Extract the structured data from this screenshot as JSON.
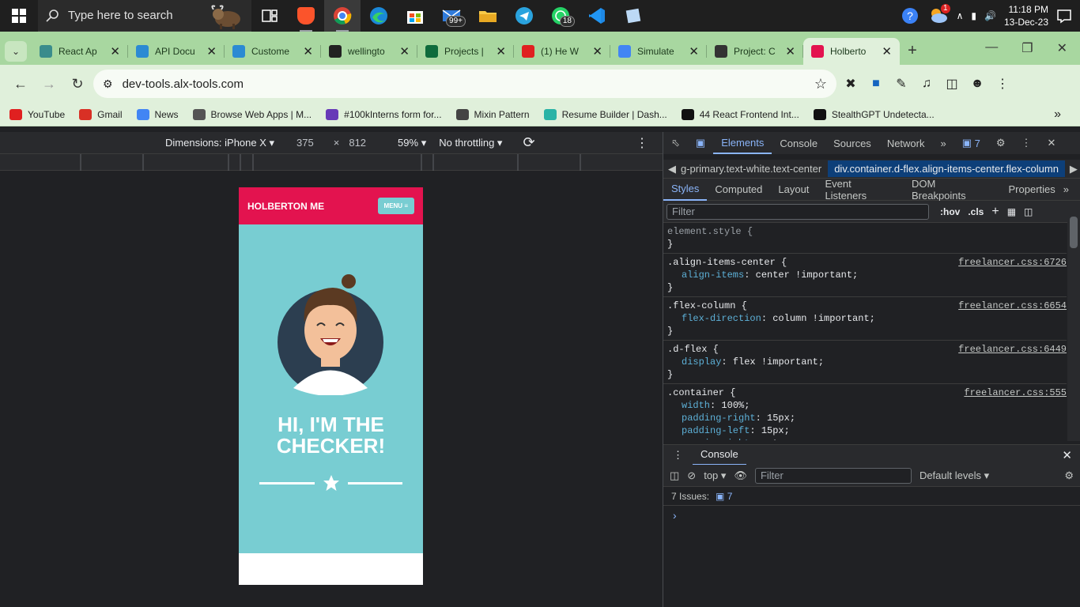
{
  "taskbar": {
    "search_placeholder": "Type here to search",
    "mail_badge": "99+",
    "whatsapp_badge": "18",
    "weather_badge": "1",
    "time": "11:18 PM",
    "date": "13-Dec-23"
  },
  "tabs": [
    {
      "title": "React Ap",
      "fav": "#3a8c8c"
    },
    {
      "title": "API Docu",
      "fav": "#2b8ad3"
    },
    {
      "title": "Custome",
      "fav": "#2b8ad3"
    },
    {
      "title": "wellingto",
      "fav": "#222222"
    },
    {
      "title": "Projects |",
      "fav": "#0e6b3c"
    },
    {
      "title": "(1) He W",
      "fav": "#e02020"
    },
    {
      "title": "Simulate",
      "fav": "#4285f4"
    },
    {
      "title": "Project: C",
      "fav": "#333333"
    },
    {
      "title": "Holberto",
      "fav": "#e3134f"
    }
  ],
  "address": {
    "url": "dev-tools.alx-tools.com"
  },
  "bookmarks": [
    {
      "label": "YouTube",
      "fav": "#e02020"
    },
    {
      "label": "Gmail",
      "fav": "#d93025"
    },
    {
      "label": "News",
      "fav": "#4285f4"
    },
    {
      "label": "Browse Web Apps | M...",
      "fav": "#555555"
    },
    {
      "label": "#100kInterns form for...",
      "fav": "#673ab7"
    },
    {
      "label": "Mixin Pattern",
      "fav": "#444444"
    },
    {
      "label": "Resume Builder | Dash...",
      "fav": "#2ab3a6"
    },
    {
      "label": "44 React Frontend Int...",
      "fav": "#111111"
    },
    {
      "label": "StealthGPT Undetecta...",
      "fav": "#111111"
    }
  ],
  "device_toolbar": {
    "dimensions": "Dimensions: iPhone X",
    "width": "375",
    "times": "×",
    "height": "812",
    "zoom": "59%",
    "throttling": "No throttling"
  },
  "page": {
    "brand": "HOLBERTON ME",
    "menu": "MENU",
    "hero_line1": "HI, I'M THE",
    "hero_line2": "CHECKER!"
  },
  "devtools": {
    "tabs": [
      "Elements",
      "Console",
      "Sources",
      "Network"
    ],
    "issues_count": "7",
    "crumb_left": "g-primary.text-white.text-center",
    "crumb_right": "div.container.d-flex.align-items-center.flex-column",
    "subtabs": [
      "Styles",
      "Computed",
      "Layout",
      "Event Listeners",
      "DOM Breakpoints",
      "Properties"
    ],
    "filter_placeholder": "Filter",
    "hov": ":hov",
    "cls": ".cls",
    "rules": [
      {
        "selector": "element.style {",
        "source": "",
        "props": []
      },
      {
        "selector": ".align-items-center {",
        "source": "freelancer.css:6726",
        "props": [
          {
            "n": "align-items",
            "v": "center !important;"
          }
        ]
      },
      {
        "selector": ".flex-column {",
        "source": "freelancer.css:6654",
        "props": [
          {
            "n": "flex-direction",
            "v": "column !important;"
          }
        ]
      },
      {
        "selector": ".d-flex {",
        "source": "freelancer.css:6449",
        "props": [
          {
            "n": "display",
            "v": "flex !important;"
          }
        ]
      },
      {
        "selector": ".container {",
        "source": "freelancer.css:555",
        "props": [
          {
            "n": "width",
            "v": "100%;"
          },
          {
            "n": "padding-right",
            "v": "15px;"
          },
          {
            "n": "padding-left",
            "v": "15px;"
          },
          {
            "n": "margin-right",
            "v": "auto;"
          }
        ]
      }
    ],
    "console_title": "Console",
    "context": "top",
    "console_filter": "Filter",
    "levels": "Default levels",
    "issues_label": "7 Issues:",
    "issues_num": "7"
  }
}
